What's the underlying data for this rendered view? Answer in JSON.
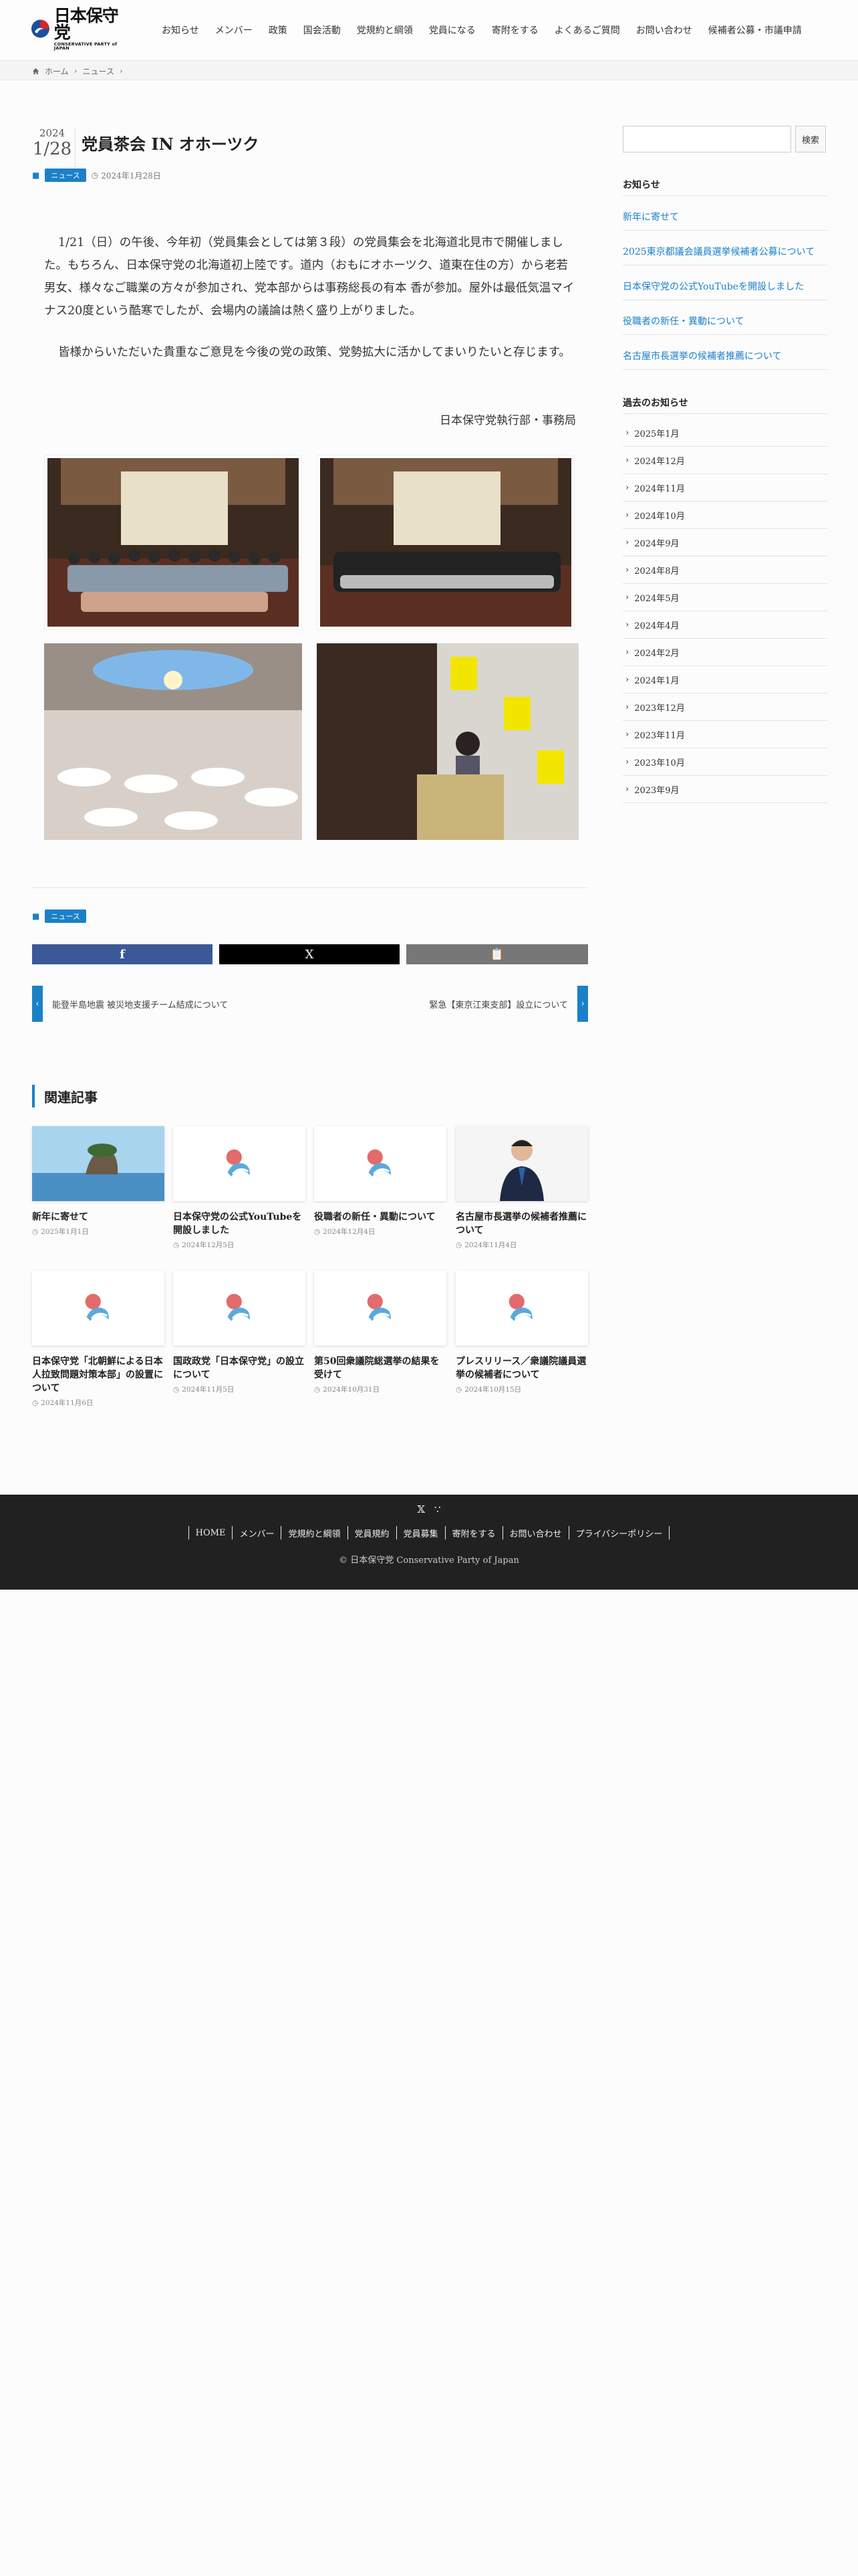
{
  "header": {
    "logo_main": "日本保守党",
    "logo_sub": "CONSERVATIVE PARTY of JAPAN",
    "nav": [
      "お知らせ",
      "メンバー",
      "政策",
      "国会活動",
      "党規約と綱領",
      "党員になる",
      "寄附をする",
      "よくあるご質問",
      "お問い合わせ",
      "候補者公募・市議申請"
    ]
  },
  "breadcrumb": {
    "home": "ホーム",
    "current": "ニュース"
  },
  "article": {
    "year": "2024",
    "monthday": "1/28",
    "title": "党員茶会 IN オホーツク",
    "category": "ニュース",
    "date": "2024年1月28日",
    "para1": "1/21（日）の午後、今年初（党員集会としては第３段）の党員集会を北海道北見市で開催しました。もちろん、日本保守党の北海道初上陸です。道内（おもにオホーツク、道東在住の方）から老若男女、様々なご職業の方々が参加され、党本部からは事務総長の有本 香が参加。屋外は最低気温マイナス20度という酷寒でしたが、会場内の議論は熱く盛り上がりました。",
    "para2": "皆様からいただいた貴重なご意見を今後の党の政策、党勢拡大に活かしてまいりたいと存じます。",
    "signature": "日本保守党執行部・事務局"
  },
  "share": {
    "facebook": "f",
    "x": "X",
    "copy": "copy"
  },
  "pager": {
    "prev": "能登半島地震 被災地支援チーム結成について",
    "next": "緊急【東京江東支部】設立について"
  },
  "related": {
    "heading": "関連記事",
    "items": [
      {
        "title": "新年に寄せて",
        "date": "2025年1月1日"
      },
      {
        "title": "日本保守党の公式YouTubeを開設しました",
        "date": "2024年12月5日"
      },
      {
        "title": "役職者の新任・異動について",
        "date": "2024年12月4日"
      },
      {
        "title": "名古屋市長選挙の候補者推薦について",
        "date": "2024年11月4日"
      },
      {
        "title": "日本保守党「北朝鮮による日本人拉致問題対策本部」の設置について",
        "date": "2024年11月6日"
      },
      {
        "title": "国政政党「日本保守党」の設立について",
        "date": "2024年11月5日"
      },
      {
        "title": "第50回衆議院総選挙の結果を受けて",
        "date": "2024年10月31日"
      },
      {
        "title": "プレスリリース／衆議院議員選挙の候補者について",
        "date": "2024年10月15日"
      }
    ]
  },
  "sidebar": {
    "search_placeholder": "",
    "search_button": "検索",
    "news_heading": "お知らせ",
    "news": [
      "新年に寄せて",
      "2025東京都議会議員選挙候補者公募について",
      "日本保守党の公式YouTubeを開設しました",
      "役職者の新任・異動について",
      "名古屋市長選挙の候補者推薦について"
    ],
    "archive_heading": "過去のお知らせ",
    "archive": [
      "2025年1月",
      "2024年12月",
      "2024年11月",
      "2024年10月",
      "2024年9月",
      "2024年8月",
      "2024年5月",
      "2024年4月",
      "2024年2月",
      "2024年1月",
      "2023年12月",
      "2023年11月",
      "2023年10月",
      "2023年9月"
    ]
  },
  "footer": {
    "nav": [
      "HOME",
      "メンバー",
      "党規約と綱領",
      "党員規約",
      "党員募集",
      "寄附をする",
      "お問い合わせ",
      "プライバシーポリシー"
    ],
    "copyright": "© 日本保守党 Conservative Party of Japan"
  },
  "colors": {
    "accent": "#1b80c8",
    "footer_bg": "#212121",
    "facebook": "#3b5998",
    "x": "#000000",
    "copy": "#777777"
  }
}
